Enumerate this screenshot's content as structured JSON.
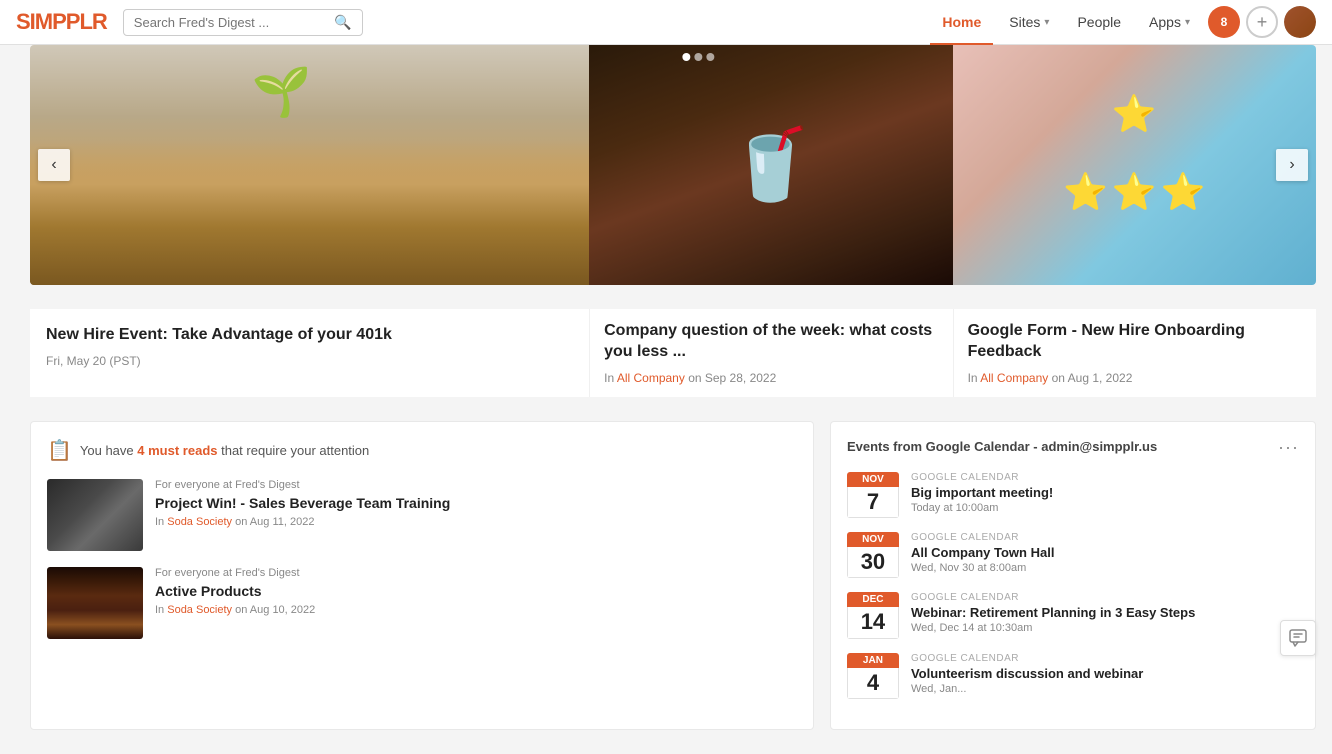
{
  "nav": {
    "logo": "SIMPPLR",
    "search_placeholder": "Search Fred's Digest ...",
    "links": [
      {
        "label": "Home",
        "active": true,
        "has_chevron": false
      },
      {
        "label": "Sites",
        "active": false,
        "has_chevron": true
      },
      {
        "label": "People",
        "active": false,
        "has_chevron": false
      },
      {
        "label": "Apps",
        "active": false,
        "has_chevron": true
      }
    ],
    "notification_count": "8",
    "add_icon": "+",
    "chevron": "▾"
  },
  "carousel": {
    "left_arrow": "‹",
    "right_arrow": "›",
    "dots": [
      "active",
      "",
      ""
    ],
    "items": [
      {
        "title": "New Hire Event: Take Advantage of your 401k",
        "date": "Fri, May 20 (PST)",
        "img_type": "coins"
      },
      {
        "title": "Company question of the week: what costs you less ...",
        "meta_prefix": "In",
        "community": "All Company",
        "date_suffix": "on Sep 28, 2022",
        "img_type": "shake"
      },
      {
        "title": "Google Form - New Hire Onboarding Feedback",
        "meta_prefix": "In",
        "community": "All Company",
        "date_suffix": "on Aug 1, 2022",
        "img_type": "stars"
      }
    ]
  },
  "must_reads": {
    "intro": "You have",
    "count": "4 must reads",
    "suffix": "that require your attention",
    "items": [
      {
        "audience": "For everyone at Fred's Digest",
        "title": "Project Win! - Sales Beverage Team Training",
        "meta_prefix": "In",
        "community": "Soda Society",
        "date": "on Aug 11, 2022",
        "img_type": "training"
      },
      {
        "audience": "For everyone at Fred's Digest",
        "title": "Active Products",
        "meta_prefix": "In",
        "community": "Soda Society",
        "date": "on Aug 10, 2022",
        "img_type": "drink"
      }
    ]
  },
  "events": {
    "title": "Events from Google Calendar - admin@simpplr.us",
    "more_icon": "···",
    "items": [
      {
        "month": "NOV",
        "day": "7",
        "source": "GOOGLE CALENDAR",
        "name": "Big important meeting!",
        "time": "Today at 10:00am"
      },
      {
        "month": "NOV",
        "day": "30",
        "source": "GOOGLE CALENDAR",
        "name": "All Company Town Hall",
        "time": "Wed, Nov 30 at 8:00am"
      },
      {
        "month": "DEC",
        "day": "14",
        "source": "GOOGLE CALENDAR",
        "name": "Webinar: Retirement Planning in 3 Easy Steps",
        "time": "Wed, Dec 14 at 10:30am"
      },
      {
        "month": "JAN",
        "day": "4",
        "source": "GOOGLE CALENDAR",
        "name": "Volunteerism discussion and webinar",
        "time": "Wed, Jan..."
      }
    ]
  }
}
